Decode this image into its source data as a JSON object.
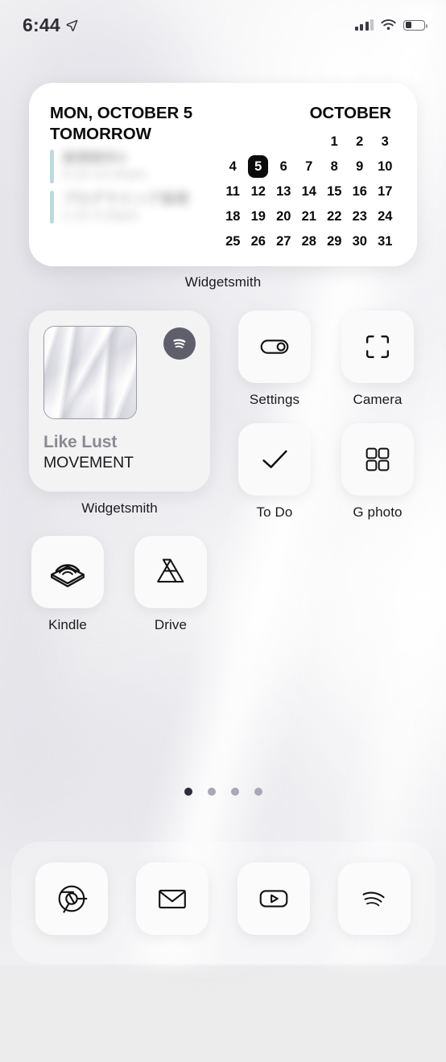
{
  "status_bar": {
    "time": "6:44",
    "location_icon": "location-arrow-icon",
    "signal_icon": "cellular-signal-icon",
    "signal_bars_filled": 3,
    "signal_bars_total": 4,
    "wifi_icon": "wifi-icon",
    "battery_icon": "battery-icon",
    "battery_level_pct": 32
  },
  "calendar_widget": {
    "app_label": "Widgetsmith",
    "header_date": "MON, OCTOBER 5",
    "month_label": "OCTOBER",
    "section_label": "TOMORROW",
    "accent_color": "#b9dbe0",
    "today": 5,
    "events": [
      {
        "title": "基礎解析II",
        "time": "9:10-10:40am",
        "redacted": true
      },
      {
        "title": "プログラミング基礎",
        "time": "1:15-4:30pm",
        "redacted": true
      }
    ],
    "grid_rows": [
      [
        "",
        "",
        "",
        "",
        "1",
        "2",
        "3"
      ],
      [
        "4",
        "5",
        "6",
        "7",
        "8",
        "9",
        "10"
      ],
      [
        "11",
        "12",
        "13",
        "14",
        "15",
        "16",
        "17"
      ],
      [
        "18",
        "19",
        "20",
        "21",
        "22",
        "23",
        "24"
      ],
      [
        "25",
        "26",
        "27",
        "28",
        "29",
        "30",
        "31"
      ]
    ]
  },
  "music_widget": {
    "app_label": "Widgetsmith",
    "service_icon": "spotify-icon",
    "service_icon_color": "#5f5f6b",
    "album_art": "album-artwork",
    "track_title": "Like Lust",
    "artist": "MOVEMENT"
  },
  "apps": [
    {
      "label": "Settings",
      "icon": "toggle-switch-icon"
    },
    {
      "label": "Camera",
      "icon": "camera-frame-icon"
    },
    {
      "label": "To Do",
      "icon": "checkmark-icon"
    },
    {
      "label": "G photo",
      "icon": "four-squares-icon"
    },
    {
      "label": "Kindle",
      "icon": "audible-book-icon"
    },
    {
      "label": "Drive",
      "icon": "google-drive-icon"
    }
  ],
  "page_dots": {
    "total": 4,
    "active_index": 0
  },
  "dock": [
    {
      "label": "Chrome",
      "icon": "chrome-icon"
    },
    {
      "label": "Gmail",
      "icon": "envelope-icon"
    },
    {
      "label": "YouTube",
      "icon": "youtube-play-icon"
    },
    {
      "label": "Spotify",
      "icon": "spotify-waves-icon"
    }
  ]
}
